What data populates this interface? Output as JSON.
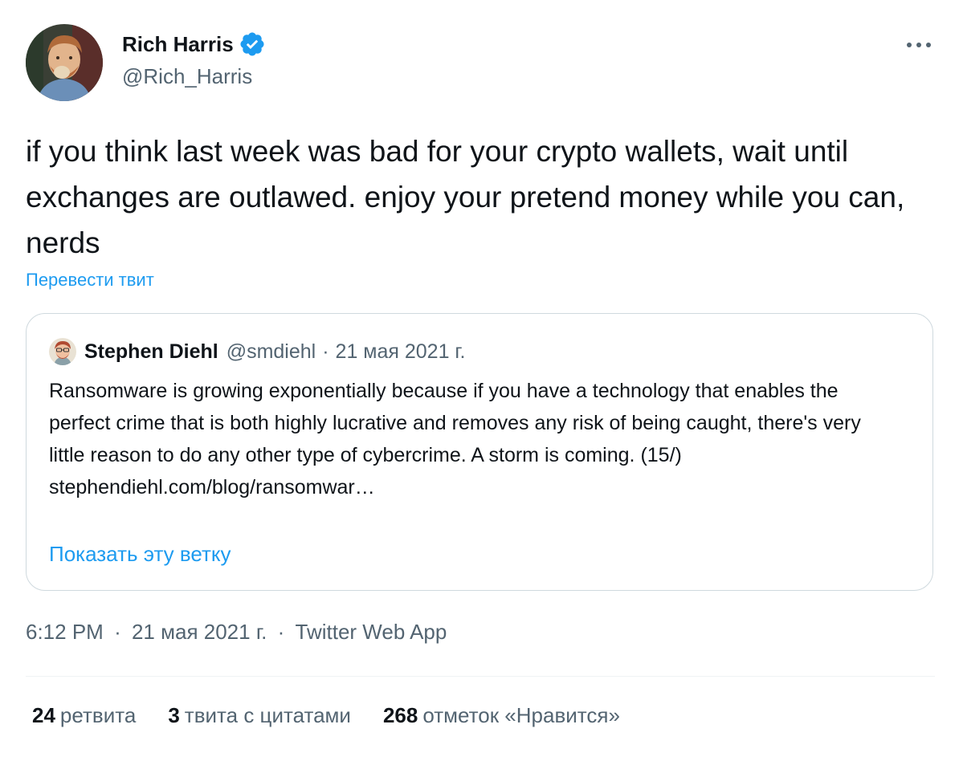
{
  "author": {
    "display_name": "Rich Harris",
    "handle": "@Rich_Harris",
    "avatar_icon": "user-avatar-photo",
    "verified_icon": "verified-badge-icon"
  },
  "tweet": {
    "text": "if you think last week was bad for your crypto wallets, wait until exchanges are outlawed. enjoy your pretend money while you can, nerds",
    "translate_label": "Перевести твит"
  },
  "quote": {
    "display_name": "Stephen Diehl",
    "handle": "@smdiehl",
    "separator": "·",
    "date": "21 мая 2021 г.",
    "text": "Ransomware is growing exponentially because if you have a technology that enables the perfect crime that is both highly lucrative and removes any risk of being caught, there's very little reason to do any other type of cybercrime. A storm is coming. (15/)",
    "link": "stephendiehl.com/blog/ransomwar…",
    "show_thread_label": "Показать эту ветку"
  },
  "meta": {
    "time": "6:12 PM",
    "separator": "·",
    "date": "21 мая 2021 г.",
    "source": "Twitter Web App"
  },
  "stats": {
    "retweets_count": "24",
    "retweets_label": "ретвита",
    "quotes_count": "3",
    "quotes_label": "твита с цитатами",
    "likes_count": "268",
    "likes_label": "отметок «Нравится»"
  },
  "colors": {
    "accent": "#1d9bf0",
    "text_primary": "#0f1419",
    "text_secondary": "#536471",
    "border": "#cfd9de"
  }
}
